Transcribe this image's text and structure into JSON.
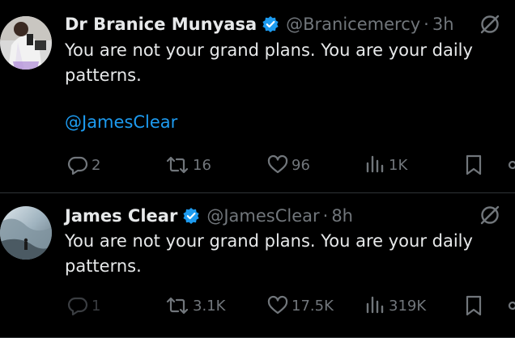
{
  "colors": {
    "background": "#000000",
    "primary_text": "#e7e9ea",
    "secondary_text": "#71767b",
    "link": "#1d9bf0",
    "verified_badge": "#1d9bf0",
    "divider": "#2f3336"
  },
  "tweets": [
    {
      "display_name": "Dr Branice Munyasa",
      "verified": true,
      "handle": "@Branicemercy",
      "separator": "·",
      "time": "3h",
      "text": "You are not your grand plans. You are your daily patterns.",
      "mention": "@JamesClear",
      "icons": {
        "reply": "reply-icon",
        "retweet": "retweet-icon",
        "like": "heart-icon",
        "views": "views-icon",
        "bookmark": "bookmark-icon",
        "share": "share-icon",
        "grok": "grok-icon"
      },
      "stats": {
        "replies": "2",
        "retweets": "16",
        "likes": "96",
        "views": "1K"
      }
    },
    {
      "display_name": "James Clear",
      "verified": true,
      "handle": "@JamesClear",
      "separator": "·",
      "time": "8h",
      "text": "You are not your grand plans. You are your daily patterns.",
      "icons": {
        "reply": "reply-icon",
        "retweet": "retweet-icon",
        "like": "heart-icon",
        "views": "views-icon",
        "bookmark": "bookmark-icon",
        "share": "share-icon",
        "grok": "grok-icon"
      },
      "stats": {
        "replies": "1",
        "retweets": "3.1K",
        "likes": "17.5K",
        "views": "319K"
      }
    }
  ]
}
